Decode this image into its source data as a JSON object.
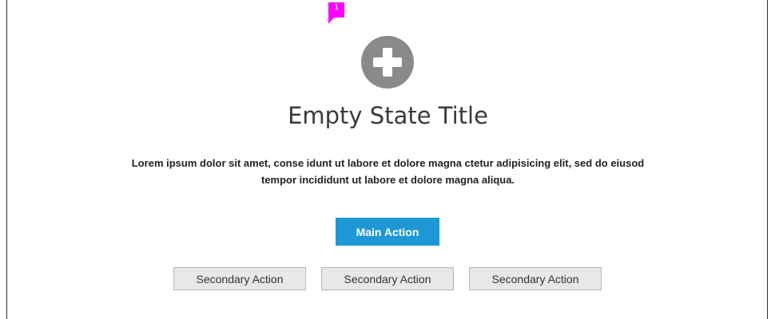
{
  "annotation": {
    "number": "1",
    "color": "#ff00ff"
  },
  "empty_state": {
    "icon": "plus-circle-icon",
    "title": "Empty State Title",
    "description": "Lorem ipsum dolor sit amet, conse idunt ut labore et dolore magna ctetur adipisicing elit, sed do eiusod tempor incididunt ut labore et dolore magna aliqua.",
    "main_action_label": "Main Action",
    "secondary_actions": [
      {
        "label": "Secondary Action"
      },
      {
        "label": "Secondary Action"
      },
      {
        "label": "Secondary Action"
      }
    ]
  },
  "colors": {
    "primary": "#1e98d5",
    "icon": "#8a8a8a",
    "secondary_bg": "#e8e8e8"
  }
}
